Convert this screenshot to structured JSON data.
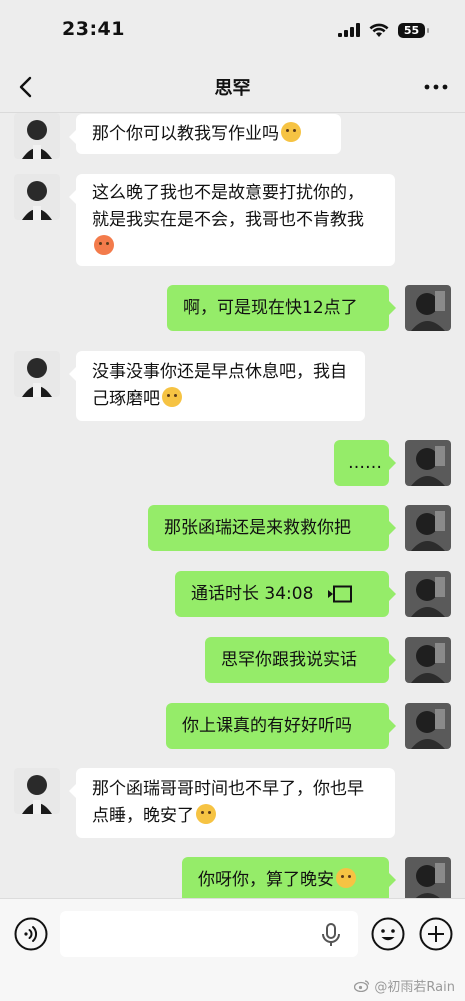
{
  "status_bar": {
    "time": "23:41",
    "battery": "55"
  },
  "nav": {
    "title": "思罕"
  },
  "messages": [
    {
      "side": "left",
      "text": "那个你可以教我写作业吗",
      "emoji": "sad"
    },
    {
      "side": "left",
      "text": "这么晚了我也不是故意要打扰你的，就是我实在是不会，我哥也不肯教我",
      "emoji": "angry"
    },
    {
      "side": "right",
      "text": "啊，可是现在快12点了"
    },
    {
      "side": "left",
      "text": "没事没事你还是早点休息吧，我自己琢磨吧",
      "emoji": "pout"
    },
    {
      "side": "right",
      "text": "……"
    },
    {
      "side": "right",
      "text": "那张函瑞还是来救救你把"
    },
    {
      "side": "right",
      "text": "通话时长 34:08",
      "call_icon": "video-call-icon"
    },
    {
      "side": "right",
      "text": "思罕你跟我说实话"
    },
    {
      "side": "right",
      "text": "你上课真的有好好听吗"
    },
    {
      "side": "left",
      "text": "那个函瑞哥哥时间也不早了，你也早点睡，晚安了",
      "emoji": "wink"
    },
    {
      "side": "right",
      "text": "你呀你，算了晚安",
      "emoji": "sleep"
    }
  ],
  "input_bar": {
    "placeholder": ""
  },
  "watermark": "@初雨若Rain",
  "colors": {
    "background": "#ededed",
    "bubble_right": "#95ec69",
    "bubble_left": "#ffffff"
  }
}
